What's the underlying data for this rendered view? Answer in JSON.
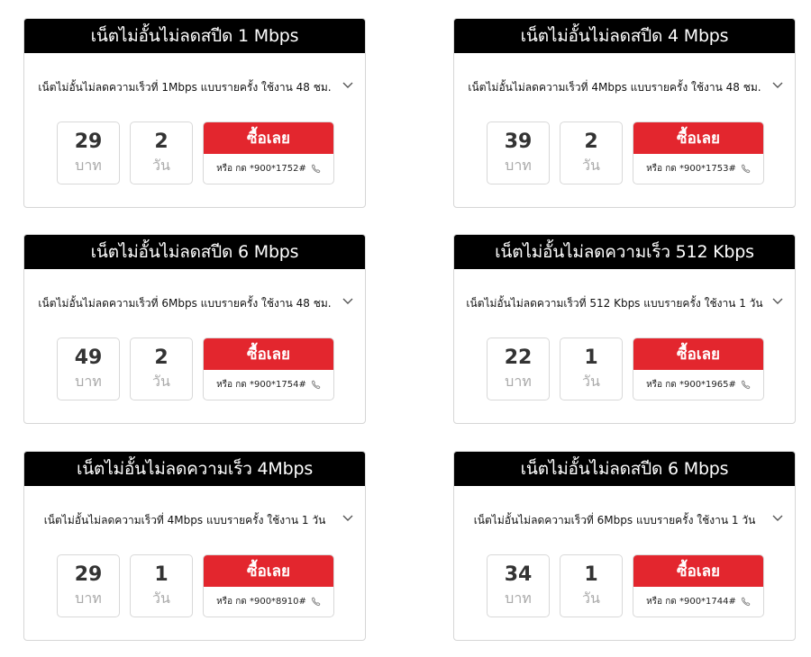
{
  "cards": [
    {
      "title": "เน็ตไม่อั้นไม่ลดสปีด 1 Mbps",
      "description": "เน็ตไม่อั้นไม่ลดความเร็วที่ 1Mbps แบบรายครั้ง ใช้งาน 48 ชม.",
      "price": "29",
      "price_unit": "บาท",
      "days": "2",
      "days_unit": "วัน",
      "buy_label": "ซื้อเลย",
      "dial_text": "หรือ กด *900*1752#",
      "icons": [
        "chevron-down-icon",
        "phone-icon"
      ]
    },
    {
      "title": "เน็ตไม่อั้นไม่ลดสปีด 4 Mbps",
      "description": "เน็ตไม่อั้นไม่ลดความเร็วที่ 4Mbps แบบรายครั้ง ใช้งาน 48 ชม.",
      "price": "39",
      "price_unit": "บาท",
      "days": "2",
      "days_unit": "วัน",
      "buy_label": "ซื้อเลย",
      "dial_text": "หรือ กด *900*1753#",
      "icons": [
        "chevron-down-icon",
        "phone-icon"
      ]
    },
    {
      "title": "เน็ตไม่อั้นไม่ลดสปีด 6 Mbps",
      "description": "เน็ตไม่อั้นไม่ลดความเร็วที่ 6Mbps แบบรายครั้ง ใช้งาน 48 ชม.",
      "price": "49",
      "price_unit": "บาท",
      "days": "2",
      "days_unit": "วัน",
      "buy_label": "ซื้อเลย",
      "dial_text": "หรือ กด *900*1754#",
      "icons": [
        "chevron-down-icon",
        "phone-icon"
      ]
    },
    {
      "title": "เน็ตไม่อั้นไม่ลดความเร็ว 512 Kbps",
      "description": "เน็ตไม่อั้นไม่ลดความเร็วที่ 512 Kbps แบบรายครั้ง ใช้งาน 1 วัน",
      "price": "22",
      "price_unit": "บาท",
      "days": "1",
      "days_unit": "วัน",
      "buy_label": "ซื้อเลย",
      "dial_text": "หรือ กด *900*1965#",
      "icons": [
        "chevron-down-icon",
        "phone-icon"
      ]
    },
    {
      "title": "เน็ตไม่อั้นไม่ลดความเร็ว 4Mbps",
      "description": "เน็ตไม่อั้นไม่ลดความเร็วที่ 4Mbps แบบรายครั้ง ใช้งาน 1 วัน",
      "price": "29",
      "price_unit": "บาท",
      "days": "1",
      "days_unit": "วัน",
      "buy_label": "ซื้อเลย",
      "dial_text": "หรือ กด *900*8910#",
      "icons": [
        "chevron-down-icon",
        "phone-icon"
      ]
    },
    {
      "title": "เน็ตไม่อั้นไม่ลดสปีด 6 Mbps",
      "description": "เน็ตไม่อั้นไม่ลดความเร็วที่ 6Mbps แบบรายครั้ง ใช้งาน 1 วัน",
      "price": "34",
      "price_unit": "บาท",
      "days": "1",
      "days_unit": "วัน",
      "buy_label": "ซื้อเลย",
      "dial_text": "หรือ กด *900*1744#",
      "icons": [
        "chevron-down-icon",
        "phone-icon"
      ]
    }
  ],
  "colors": {
    "header_bg": "#000000",
    "buy_button": "#e3262e",
    "unit_text": "#aaaaaa",
    "border": "#d6d6d6"
  }
}
